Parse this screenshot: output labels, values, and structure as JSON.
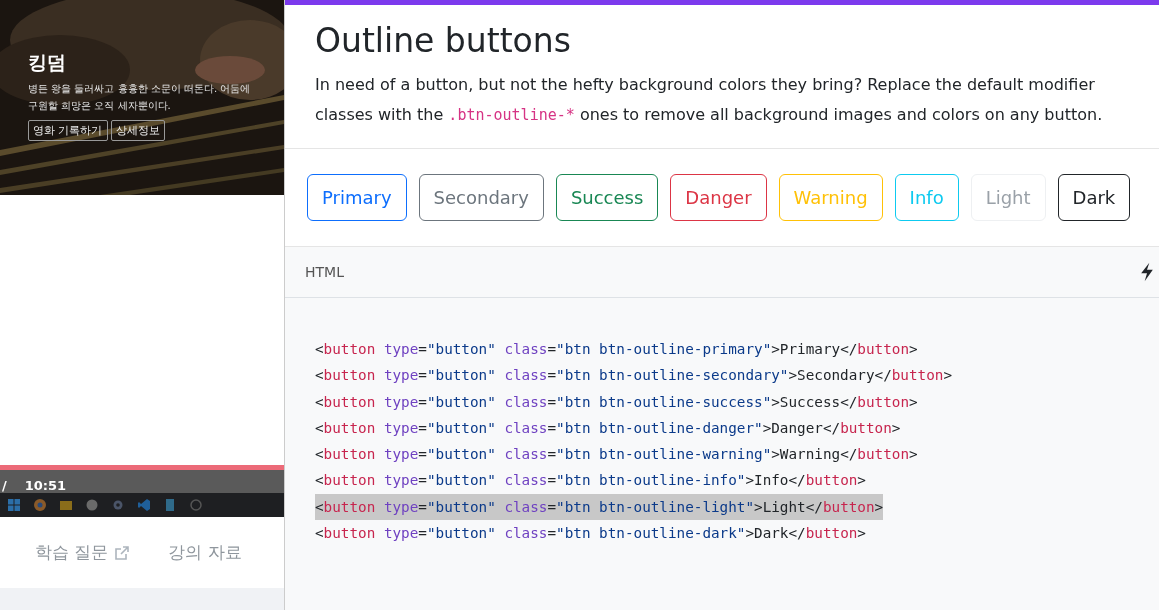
{
  "video": {
    "title": "킹덤",
    "description": "병든 왕을 둘러싸고 흉흉한 소문이 떠돈다. 어둠에\n구원할 희망은 오직 세자뿐이다.",
    "buttons": [
      "영화 기록하기",
      "상세정보"
    ],
    "progress": {
      "level": 1
    },
    "time_separator": "/",
    "time": "10:51"
  },
  "lecture_links": [
    {
      "label": "학습 질문",
      "external": true
    },
    {
      "label": "강의 자료",
      "external": false
    }
  ],
  "doc": {
    "title": "Outline buttons",
    "intro": [
      {
        "kind": "text",
        "text": "In need of a button, but not the hefty background colors they bring? Replace the default modifier classes with the "
      },
      {
        "kind": "code",
        "text": ".btn-outline-*"
      },
      {
        "kind": "text",
        "text": " ones to remove all background images and colors on any button."
      }
    ],
    "buttons": [
      {
        "label": "Primary",
        "kind": "primary"
      },
      {
        "label": "Secondary",
        "kind": "secondary"
      },
      {
        "label": "Success",
        "kind": "success"
      },
      {
        "label": "Danger",
        "kind": "danger"
      },
      {
        "label": "Warning",
        "kind": "warning"
      },
      {
        "label": "Info",
        "kind": "info"
      },
      {
        "label": "Light",
        "kind": "light"
      },
      {
        "label": "Dark",
        "kind": "dark"
      }
    ],
    "code_header": "HTML",
    "code_lines": [
      {
        "text": "<button type=\"button\" class=\"btn btn-outline-primary\">Primary</button>",
        "selected": false
      },
      {
        "text": "<button type=\"button\" class=\"btn btn-outline-secondary\">Secondary</button>",
        "selected": false
      },
      {
        "text": "<button type=\"button\" class=\"btn btn-outline-success\">Success</button>",
        "selected": false
      },
      {
        "text": "<button type=\"button\" class=\"btn btn-outline-danger\">Danger</button>",
        "selected": false
      },
      {
        "text": "<button type=\"button\" class=\"btn btn-outline-warning\">Warning</button>",
        "selected": false
      },
      {
        "text": "<button type=\"button\" class=\"btn btn-outline-info\">Info</button>",
        "selected": false
      },
      {
        "text": "<button type=\"button\" class=\"btn btn-outline-light\">Light</button>",
        "selected": true
      },
      {
        "text": "<button type=\"button\" class=\"btn btn-outline-dark\">Dark</button>",
        "selected": false
      }
    ]
  }
}
